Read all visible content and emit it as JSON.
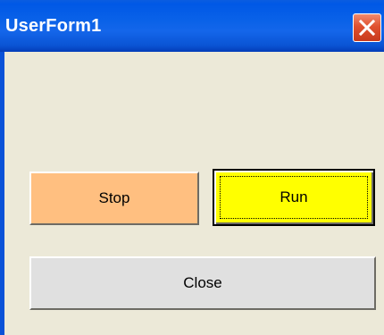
{
  "window": {
    "title": "UserForm1"
  },
  "buttons": {
    "stop_label": "Stop",
    "run_label": "Run",
    "close_label": "Close"
  },
  "icons": {
    "close": "close-icon"
  },
  "colors": {
    "titlebar": "#0a5de0",
    "form_background": "#ece9d8",
    "stop_button": "#ffbf80",
    "run_button": "#ffff00",
    "close_button": "#e0e0e0",
    "close_icon": "#e0512f"
  }
}
